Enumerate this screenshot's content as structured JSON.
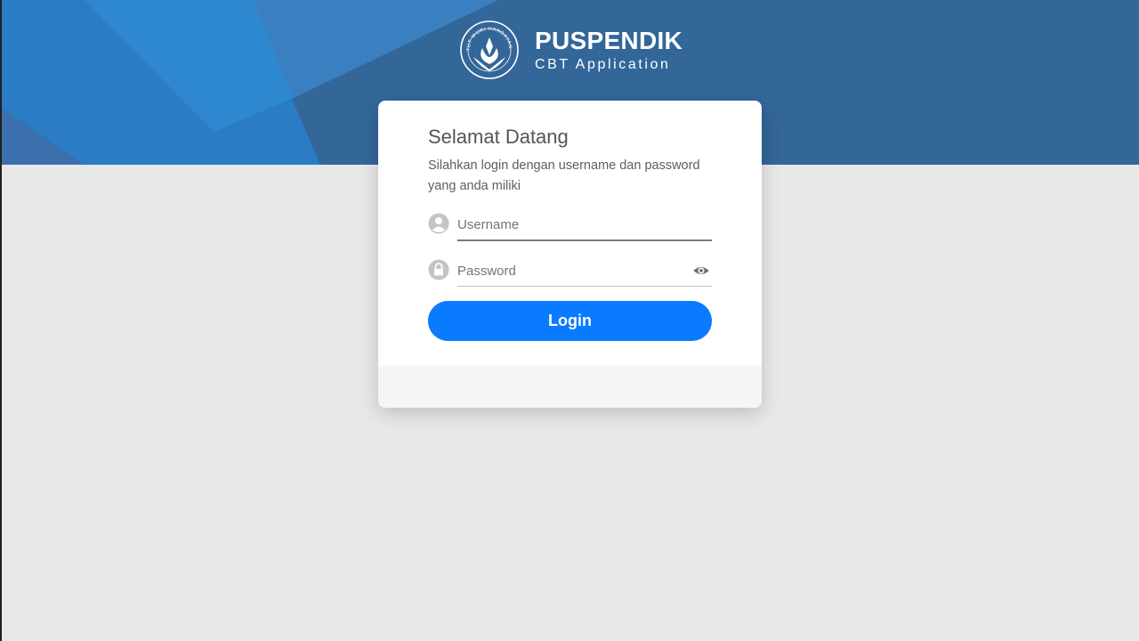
{
  "brand": {
    "title": "PUSPENDIK",
    "subtitle": "CBT Application",
    "emblem_icon": "tut-wuri-handayani-emblem-icon",
    "emblem_motto": "TUT WURI HANDAYANI"
  },
  "login_card": {
    "title": "Selamat Datang",
    "description": "Silahkan login dengan username dan password yang anda miliki",
    "username": {
      "placeholder": "Username",
      "value": "",
      "icon": "user-icon"
    },
    "password": {
      "placeholder": "Password",
      "value": "",
      "icon": "lock-icon",
      "toggle_icon": "eye-icon"
    },
    "login_label": "Login"
  },
  "colors": {
    "header_bg": "#336699",
    "page_bg": "#e8e8e8",
    "button": "#0a7aff",
    "card_footer": "#f5f5f5"
  }
}
